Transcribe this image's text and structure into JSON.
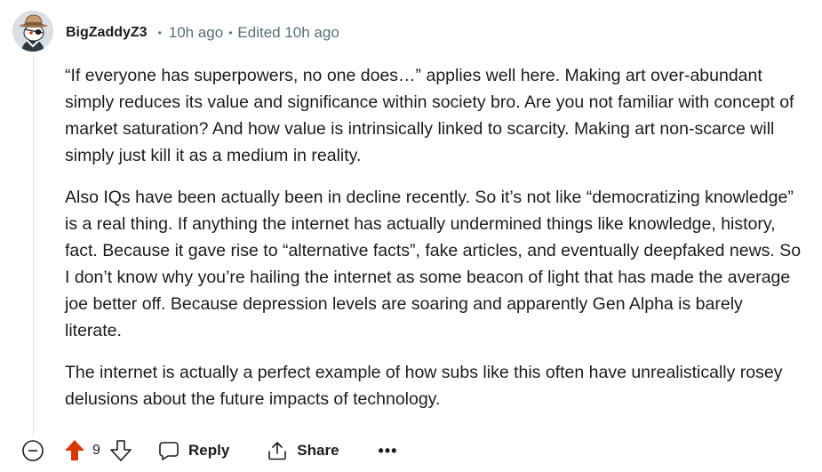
{
  "comment": {
    "author": "BigZaddyZ3",
    "separator": "•",
    "time_ago": "10h ago",
    "edited": "Edited 10h ago",
    "paragraphs": [
      "“If everyone has superpowers, no one does…” applies well here. Making art over-abundant simply reduces its value and significance within society bro. Are you not familiar with concept of market saturation? And how value is intrinsically linked to scarcity. Making art non-scarce will simply just kill it as a medium in reality.",
      "Also IQs have been actually been in decline recently. So it’s not like “democratizing knowledge” is a real thing. If anything the internet has actually undermined things like knowledge, history, fact. Because it gave rise to “alternative facts”, fake articles, and eventually deepfaked news. So I don’t know why you’re hailing the internet as some beacon of light that has made the average joe better off. Because depression levels are soaring and apparently Gen Alpha is barely literate.",
      "The internet is actually a perfect example of how subs like this often have unrealistically rosey delusions about the future impacts of technology."
    ]
  },
  "actions": {
    "score": "9",
    "reply_label": "Reply",
    "share_label": "Share",
    "more_label": "•••"
  },
  "icons": {
    "collapse": "minus-circle-icon",
    "upvote": "upvote-arrow-icon",
    "downvote": "downvote-arrow-icon",
    "reply": "speech-bubble-icon",
    "share": "share-arrow-icon",
    "more": "ellipsis-icon"
  },
  "colors": {
    "upvote_active": "#d93900",
    "meta_text": "#576f76",
    "body_text": "#1c1c1c"
  }
}
